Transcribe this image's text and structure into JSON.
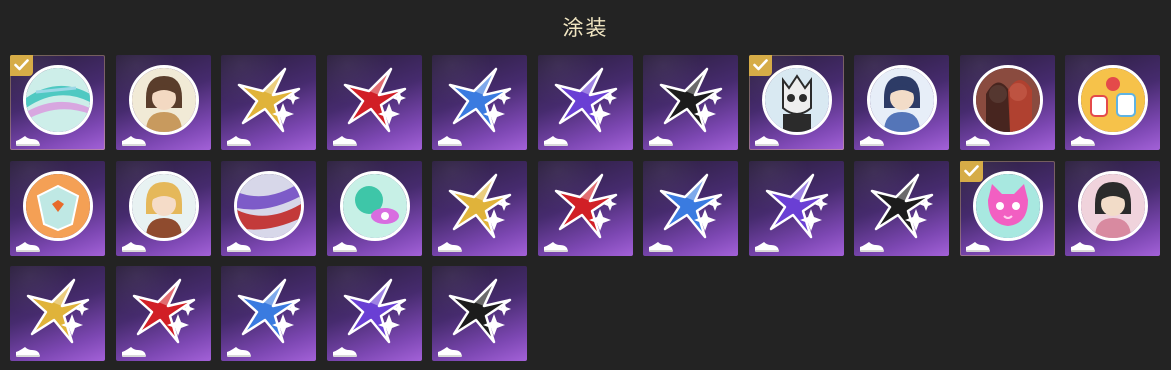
{
  "title": "涂装",
  "items": [
    {
      "type": "circle",
      "art": "stripes",
      "bg": "#cdeee9",
      "colors": [
        "#4fc9c2",
        "#9ad8e6",
        "#d8a7e0"
      ],
      "equipped": true
    },
    {
      "type": "circle",
      "art": "portrait",
      "bg": "#f1ead6",
      "colors": [
        "#5a3d2b",
        "#f3d9c2",
        "#c89a5e"
      ],
      "equipped": false
    },
    {
      "type": "star",
      "color": "#e0b33a",
      "equipped": false
    },
    {
      "type": "star",
      "color": "#d11f26",
      "equipped": false
    },
    {
      "type": "star",
      "color": "#3a7be0",
      "equipped": false
    },
    {
      "type": "star",
      "color": "#6a3fd4",
      "equipped": false
    },
    {
      "type": "star",
      "color": "#1c1c1c",
      "equipped": false
    },
    {
      "type": "circle",
      "art": "skull",
      "bg": "#d9e9f2",
      "colors": [
        "#2b2b2b",
        "#eeeeee",
        "#4fa8d1"
      ],
      "equipped": true
    },
    {
      "type": "circle",
      "art": "chibi",
      "bg": "#e7eef8",
      "colors": [
        "#2d3b66",
        "#f2dcc8",
        "#5475b8"
      ],
      "equipped": false
    },
    {
      "type": "circle",
      "art": "duo",
      "bg": "#8a4b3f",
      "colors": [
        "#3b1f1a",
        "#e8c4ae",
        "#b6402e"
      ],
      "equipped": false
    },
    {
      "type": "circle",
      "art": "mascots",
      "bg": "#f6c24a",
      "colors": [
        "#e44a4a",
        "#ffffff",
        "#5fb3e3"
      ],
      "equipped": false
    },
    {
      "type": "circle",
      "art": "mech",
      "bg": "#f4a055",
      "colors": [
        "#bfe8e4",
        "#ffffff",
        "#e86a2a"
      ],
      "equipped": false
    },
    {
      "type": "circle",
      "art": "chibi-blonde",
      "bg": "#e8f2f2",
      "colors": [
        "#e5b85a",
        "#f5dcc8",
        "#8f4b2e"
      ],
      "equipped": false
    },
    {
      "type": "circle",
      "art": "brush",
      "bg": "#d7d7e9",
      "colors": [
        "#c33a3a",
        "#7d5bc8",
        "#ffffff"
      ],
      "equipped": false
    },
    {
      "type": "circle",
      "art": "planet",
      "bg": "#c7f0e6",
      "colors": [
        "#3ec6a8",
        "#d86de0",
        "#ffffff"
      ],
      "equipped": false
    },
    {
      "type": "star",
      "color": "#e0b33a",
      "equipped": false
    },
    {
      "type": "star",
      "color": "#d11f26",
      "equipped": false
    },
    {
      "type": "star",
      "color": "#3a7be0",
      "equipped": false
    },
    {
      "type": "star",
      "color": "#6a3fd4",
      "equipped": false
    },
    {
      "type": "star",
      "color": "#1c1c1c",
      "equipped": false
    },
    {
      "type": "circle",
      "art": "cat",
      "bg": "#a8e8e0",
      "colors": [
        "#f25fc2",
        "#ffd0ee",
        "#ffffff"
      ],
      "equipped": true
    },
    {
      "type": "circle",
      "art": "portrait-dark",
      "bg": "#f0d3dc",
      "colors": [
        "#2b2b2b",
        "#f2dcc8",
        "#d88aa0"
      ],
      "equipped": false
    },
    {
      "type": "star",
      "color": "#e0b33a",
      "equipped": false
    },
    {
      "type": "star",
      "color": "#d11f26",
      "equipped": false
    },
    {
      "type": "star",
      "color": "#3a7be0",
      "equipped": false
    },
    {
      "type": "star",
      "color": "#6a3fd4",
      "equipped": false
    },
    {
      "type": "star",
      "color": "#1c1c1c",
      "equipped": false
    }
  ]
}
